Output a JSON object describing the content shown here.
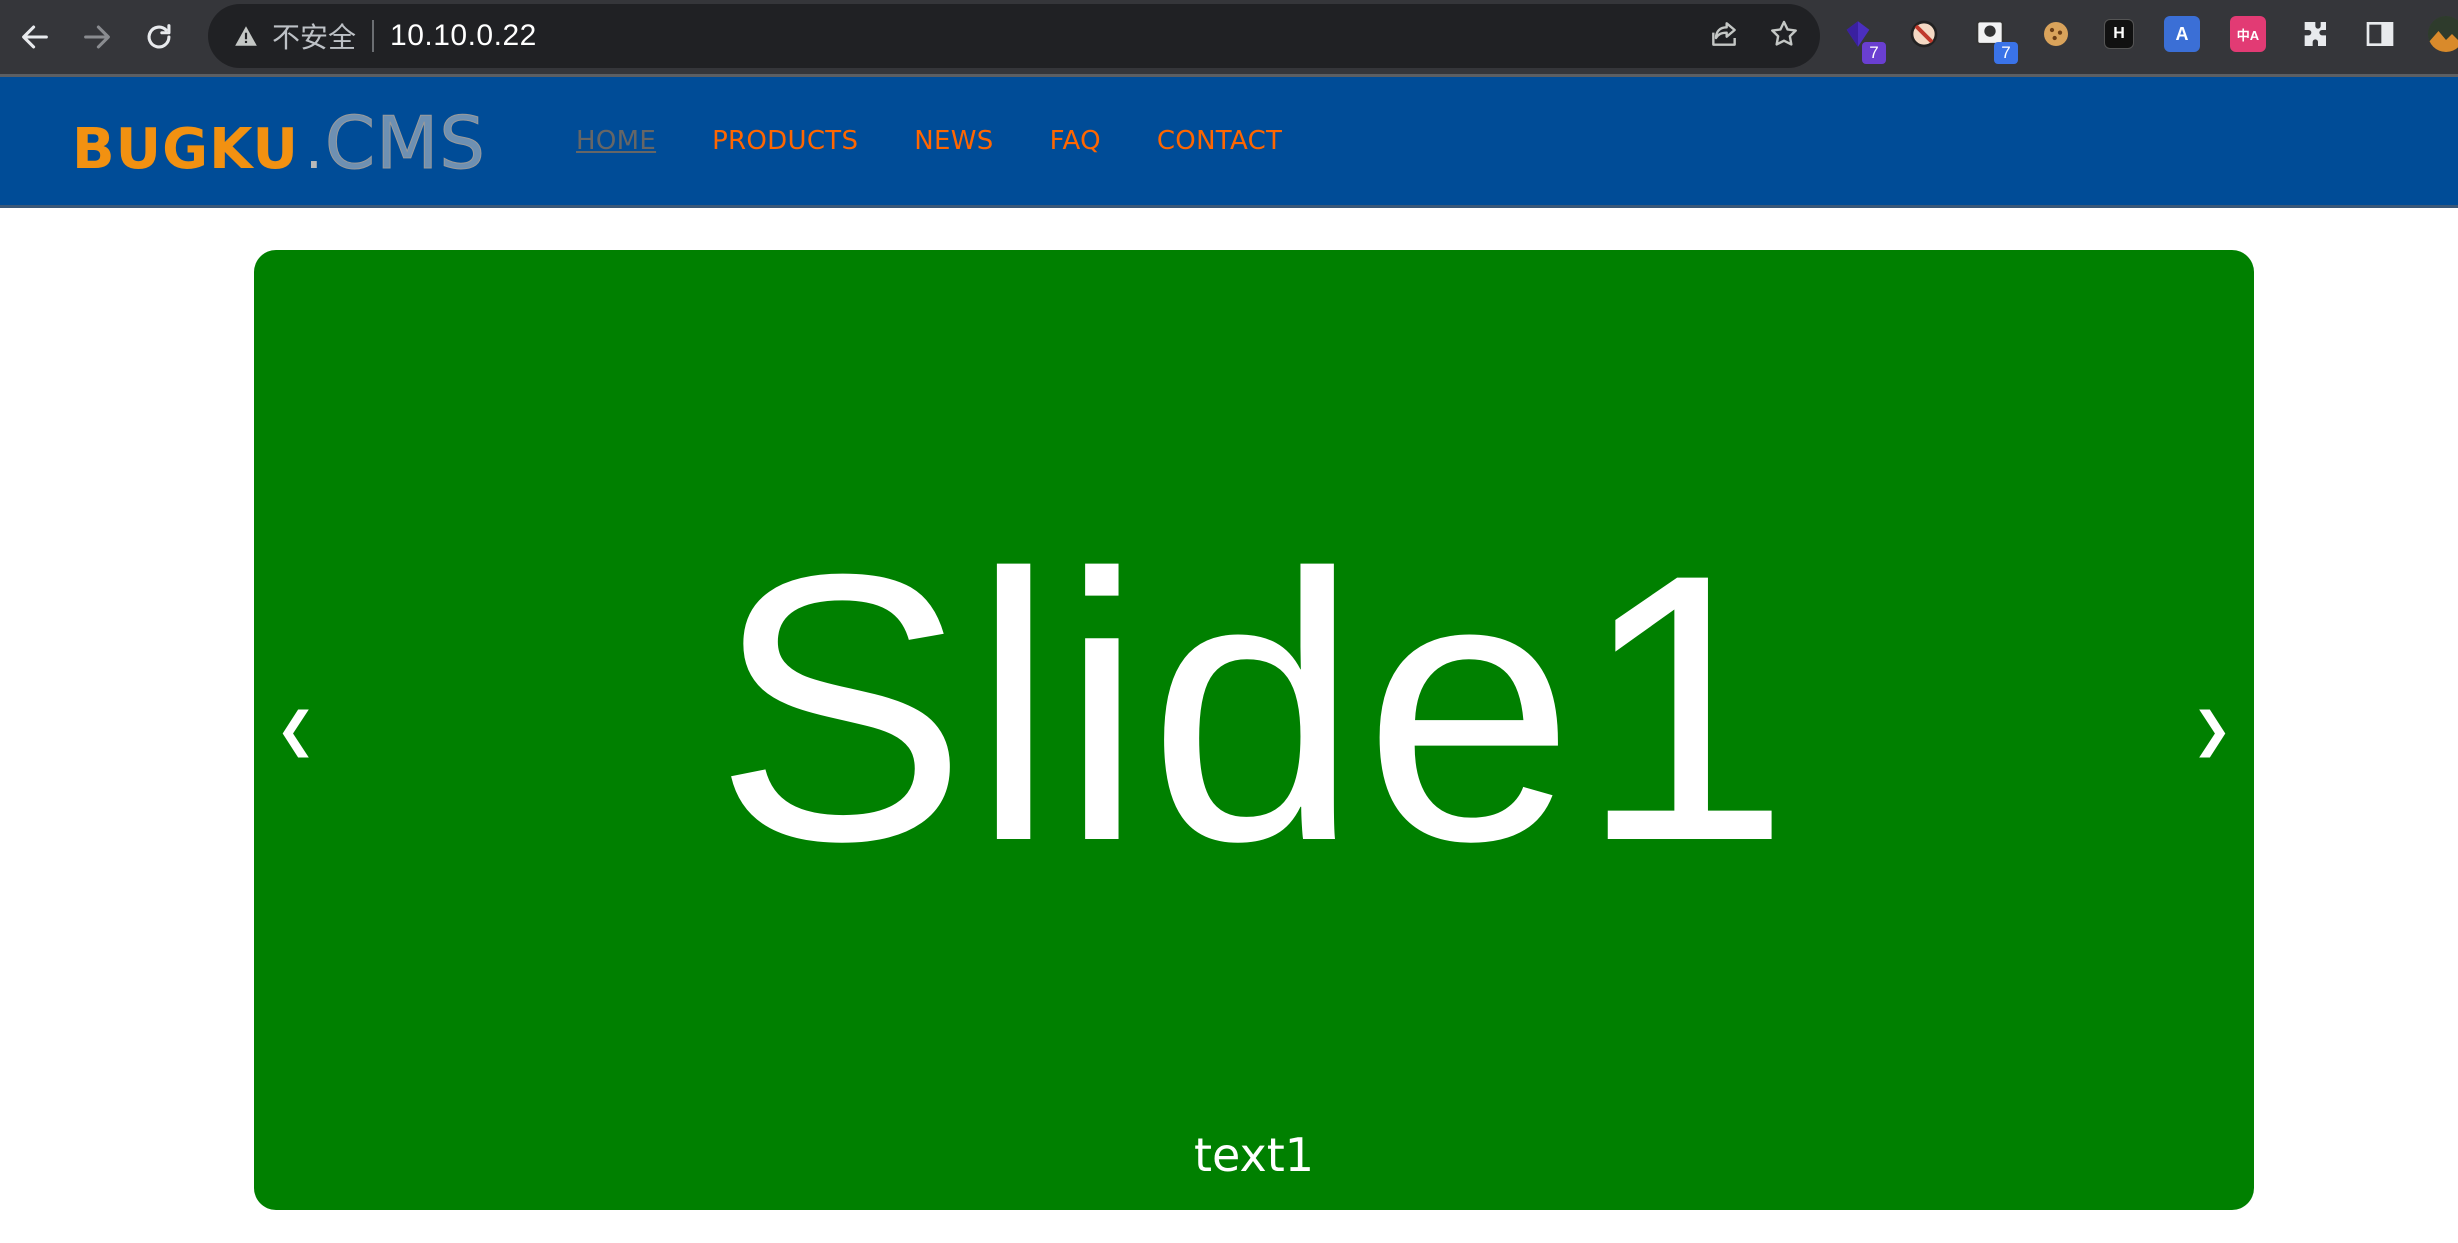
{
  "browser": {
    "security_label": "不安全",
    "url": "10.10.0.22",
    "extensions": [
      {
        "icon": "purple-gem-extension-icon",
        "badge": "7",
        "badge_color": "#6a3fd1"
      },
      {
        "icon": "blocked-circle-extension-icon",
        "badge": ""
      },
      {
        "icon": "monitor-extension-icon",
        "badge": "7",
        "badge_color": "#3a73e8"
      },
      {
        "icon": "cookie-extension-icon",
        "badge": ""
      },
      {
        "icon": "h-box-extension-icon",
        "label": "H"
      },
      {
        "icon": "translate-extension-icon",
        "label": "A"
      },
      {
        "icon": "chinese-translate-extension-icon",
        "label": "中A"
      },
      {
        "icon": "puzzle-extensions-icon"
      },
      {
        "icon": "side-panel-icon"
      },
      {
        "icon": "profile-avatar-icon"
      }
    ]
  },
  "header": {
    "logo": {
      "bold": "BUGKU",
      "dot": ".",
      "light": "CMS"
    },
    "nav": [
      {
        "label": "HOME",
        "active": true
      },
      {
        "label": "PRODUCTS",
        "active": false
      },
      {
        "label": "NEWS",
        "active": false
      },
      {
        "label": "FAQ",
        "active": false
      },
      {
        "label": "CONTACT",
        "active": false
      }
    ]
  },
  "slider": {
    "heading": "Slide1",
    "caption": "text1",
    "prev_symbol": "❮",
    "next_symbol": "❯",
    "background_color": "#008000"
  },
  "colors": {
    "header_bg": "#004c97",
    "nav_link": "#ff6600",
    "nav_active": "#666666",
    "logo_orange": "#f29111"
  }
}
